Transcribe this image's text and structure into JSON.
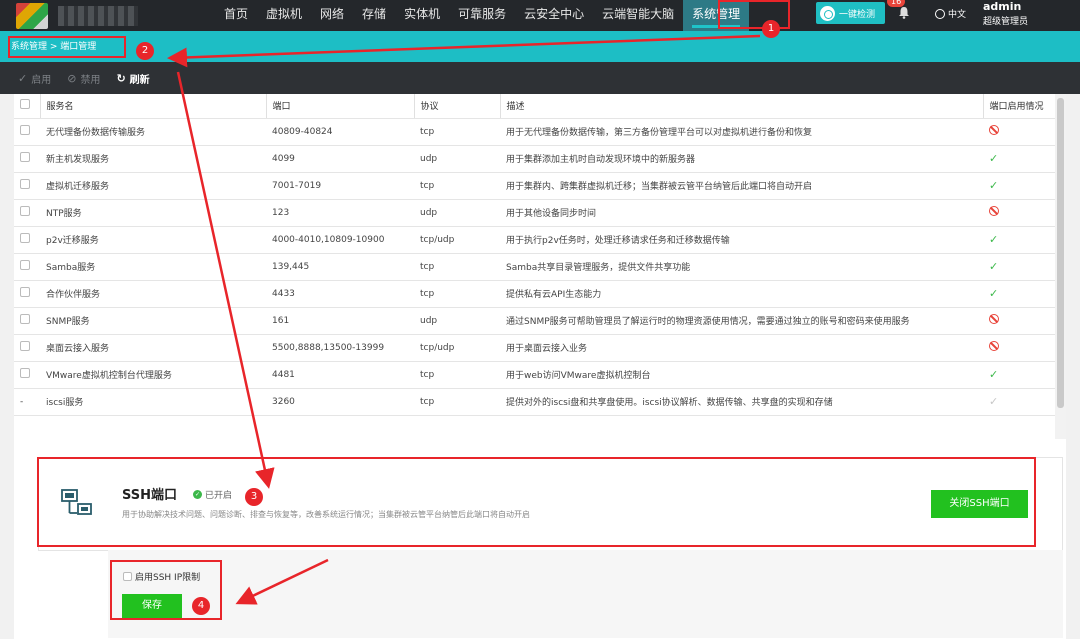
{
  "nav": {
    "items": [
      "首页",
      "虚拟机",
      "网络",
      "存储",
      "实体机",
      "可靠服务",
      "云安全中心",
      "云端智能大脑",
      "系统管理"
    ],
    "check_label": "一键检测",
    "badge_count": "16",
    "lang": "中文",
    "user_name": "admin",
    "user_role": "超级管理员"
  },
  "breadcrumb": "系统管理 > 端口管理",
  "toolbar": {
    "enable": "启用",
    "disable": "禁用",
    "refresh": "刷新"
  },
  "table": {
    "headers": [
      "服务名",
      "端口",
      "协议",
      "描述",
      "端口启用情况"
    ],
    "rows": [
      {
        "name": "无代理备份数据传输服务",
        "port": "40809-40824",
        "proto": "tcp",
        "desc": "用于无代理备份数据传输，第三方备份管理平台可以对虚拟机进行备份和恢复",
        "status": "disabled"
      },
      {
        "name": "新主机发现服务",
        "port": "4099",
        "proto": "udp",
        "desc": "用于集群添加主机时自动发现环境中的新服务器",
        "status": "enabled"
      },
      {
        "name": "虚拟机迁移服务",
        "port": "7001-7019",
        "proto": "tcp",
        "desc": "用于集群内、跨集群虚拟机迁移；当集群被云管平台纳管后此端口将自动开启",
        "status": "enabled"
      },
      {
        "name": "NTP服务",
        "port": "123",
        "proto": "udp",
        "desc": "用于其他设备同步时间",
        "status": "disabled"
      },
      {
        "name": "p2v迁移服务",
        "port": "4000-4010,10809-10900",
        "proto": "tcp/udp",
        "desc": "用于执行p2v任务时，处理迁移请求任务和迁移数据传输",
        "status": "enabled"
      },
      {
        "name": "Samba服务",
        "port": "139,445",
        "proto": "tcp",
        "desc": "Samba共享目录管理服务，提供文件共享功能",
        "status": "enabled"
      },
      {
        "name": "合作伙伴服务",
        "port": "4433",
        "proto": "tcp",
        "desc": "提供私有云API生态能力",
        "status": "enabled"
      },
      {
        "name": "SNMP服务",
        "port": "161",
        "proto": "udp",
        "desc": "通过SNMP服务可帮助管理员了解运行时的物理资源使用情况，需要通过独立的账号和密码来使用服务",
        "status": "disabled"
      },
      {
        "name": "桌面云接入服务",
        "port": "5500,8888,13500-13999",
        "proto": "tcp/udp",
        "desc": "用于桌面云接入业务",
        "status": "disabled"
      },
      {
        "name": "VMware虚拟机控制台代理服务",
        "port": "4481",
        "proto": "tcp",
        "desc": "用于web访问VMware虚拟机控制台",
        "status": "enabled"
      },
      {
        "name": "iscsi服务",
        "port": "3260",
        "proto": "tcp",
        "desc": "提供对外的iscsi盘和共享盘使用。iscsi协议解析、数据传输、共享盘的实现和存储",
        "status": "fixed",
        "check": "-"
      }
    ]
  },
  "ssh": {
    "title": "SSH端口",
    "status": "已开启",
    "description": "用于协助解决技术问题、问题诊断、排查与恢复等，改善系统运行情况；当集群被云管平台纳管后此端口将自动开启",
    "close_label": "关闭SSH端口",
    "limit_label": "启用SSH IP限制",
    "save_label": "保存"
  },
  "annotations": [
    "1",
    "2",
    "3",
    "4"
  ],
  "colors": {
    "accent": "#1dbec5",
    "danger": "#e8443a",
    "ok": "#3cb84a",
    "primary_button": "#22c11f",
    "annotation": "#e8252a"
  }
}
